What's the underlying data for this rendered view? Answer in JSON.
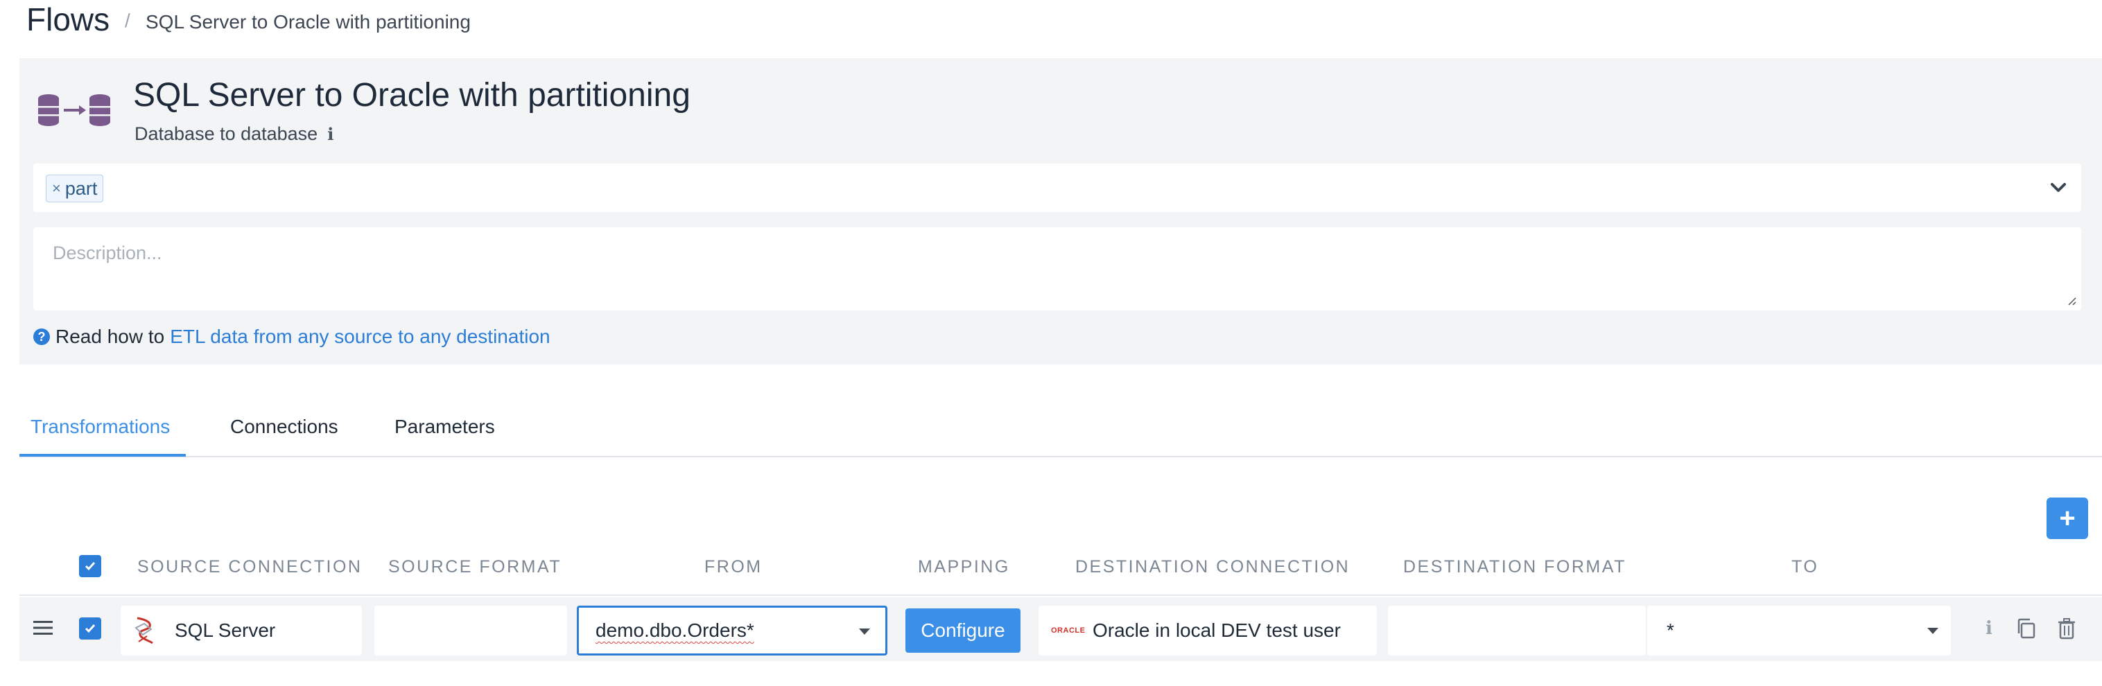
{
  "breadcrumb": {
    "root": "Flows",
    "separator": "/",
    "current": "SQL Server to Oracle with partitioning"
  },
  "flow": {
    "title": "SQL Server to Oracle with partitioning",
    "type": "Database to database",
    "info_icon": "info-icon"
  },
  "tags": {
    "items": [
      {
        "remove": "×",
        "label": "part"
      }
    ]
  },
  "description": {
    "placeholder": "Description..."
  },
  "help": {
    "prefix": "Read how to",
    "link": "ETL data from any source to any destination"
  },
  "tabs": [
    {
      "label": "Transformations",
      "active": true
    },
    {
      "label": "Connections",
      "active": false
    },
    {
      "label": "Parameters",
      "active": false
    }
  ],
  "add_button": {
    "label": "+"
  },
  "table": {
    "columns": [
      "Source connection",
      "Source format",
      "From",
      "Mapping",
      "Destination connection",
      "Destination format",
      "To"
    ],
    "rows": [
      {
        "checked": true,
        "source_connection": "SQL Server",
        "source_format": "",
        "from": "demo.dbo.Orders*",
        "mapping_button": "Configure",
        "destination_logo": "ORACLE",
        "destination_connection": "Oracle in local DEV test user",
        "destination_format": "",
        "to": "*"
      }
    ]
  },
  "colors": {
    "accent": "#3b8fe6",
    "panel": "#f2f4f6",
    "spell_error": "#e04343"
  }
}
